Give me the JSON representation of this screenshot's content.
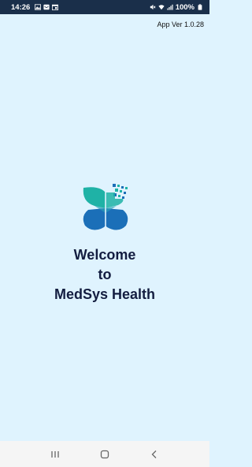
{
  "status_bar": {
    "time": "14:26",
    "battery_text": "100%",
    "left_icons": [
      "gallery-icon",
      "message-icon",
      "calendar-icon"
    ],
    "right_icons": [
      "mute-icon",
      "wifi-icon",
      "signal-icon",
      "battery-icon"
    ]
  },
  "app_version": "App Ver 1.0.28",
  "welcome": {
    "line1": "Welcome",
    "line2": "to",
    "line3": "MedSys Health"
  },
  "nav_bar": {
    "buttons": [
      "recent-apps-icon",
      "home-icon",
      "back-icon"
    ]
  },
  "colors": {
    "background": "#dff3fe",
    "status_bar": "#1a2f4a",
    "title_text": "#131d40",
    "logo_teal": "#1fb2a6",
    "logo_blue": "#1b6fb8",
    "nav_bar": "#f5f5f5"
  }
}
